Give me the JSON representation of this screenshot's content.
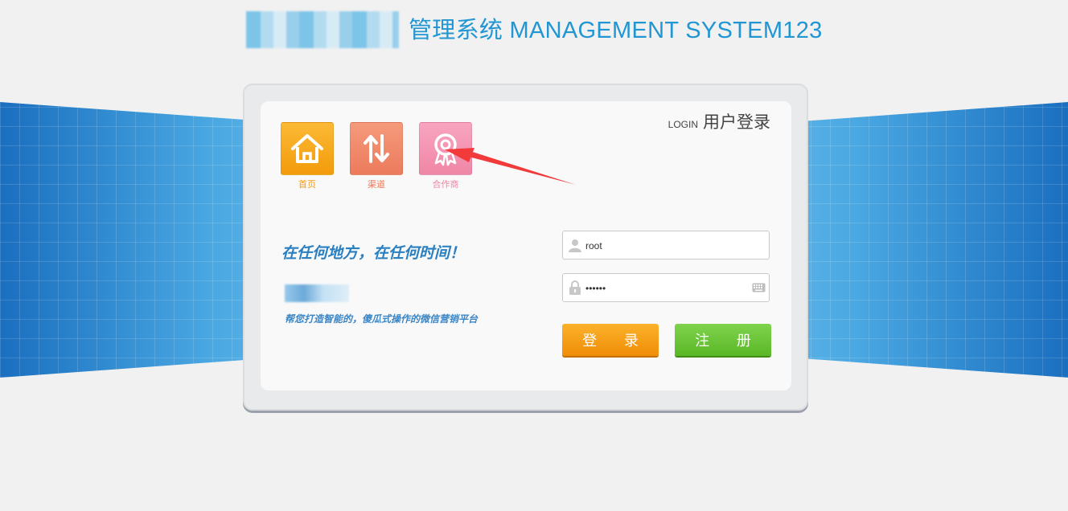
{
  "header": {
    "system_title": "管理系统 MANAGEMENT SYSTEM123"
  },
  "login_panel": {
    "heading_en": "LOGIN",
    "heading_zh": "用户登录"
  },
  "nav_tiles": [
    {
      "label": "首页",
      "icon": "home-icon",
      "color": "#f7a91e"
    },
    {
      "label": "渠道",
      "icon": "swap-arrows-icon",
      "color": "#f08b6a"
    },
    {
      "label": "合作商",
      "icon": "ribbon-badge-icon",
      "color": "#f495b1"
    }
  ],
  "promo": {
    "slogan": "在任何地方，在任何时间！",
    "tagline": "帮您打造智能的，傻瓜式操作的微信营销平台"
  },
  "form": {
    "username_value": "root",
    "password_value": "123456",
    "login_button": "登 录",
    "register_button": "注 册"
  },
  "colors": {
    "title_blue": "#2196d3",
    "login_orange": "#f59e14",
    "register_green": "#6cc43a",
    "annotation_red": "#f23a3a"
  }
}
